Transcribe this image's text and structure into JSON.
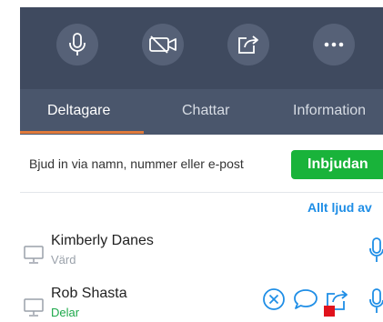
{
  "tabs": [
    {
      "label": "Deltagare",
      "active": true
    },
    {
      "label": "Chattar",
      "active": false
    },
    {
      "label": "Information",
      "active": false
    }
  ],
  "invite": {
    "placeholder": "Bjud in via namn, nummer eller e-post",
    "button_label": "Inbjudan"
  },
  "mute_all_label": "Allt ljud av",
  "participants": [
    {
      "name": "Kimberly Danes",
      "role": "Värd"
    },
    {
      "name": "Rob Shasta",
      "role": "Delar"
    }
  ],
  "toolbar_icons": [
    "microphone-icon",
    "video-off-icon",
    "share-icon",
    "more-icon"
  ],
  "colors": {
    "toolbar_bg": "#3f4a5f",
    "tabbar_bg": "#4a566c",
    "active_tab_underline": "#e07a3b",
    "invite_button": "#19b33a",
    "link_blue": "#1f8ee6",
    "sharing_green": "#1da84a",
    "share_indicator_red": "#e0121c"
  }
}
